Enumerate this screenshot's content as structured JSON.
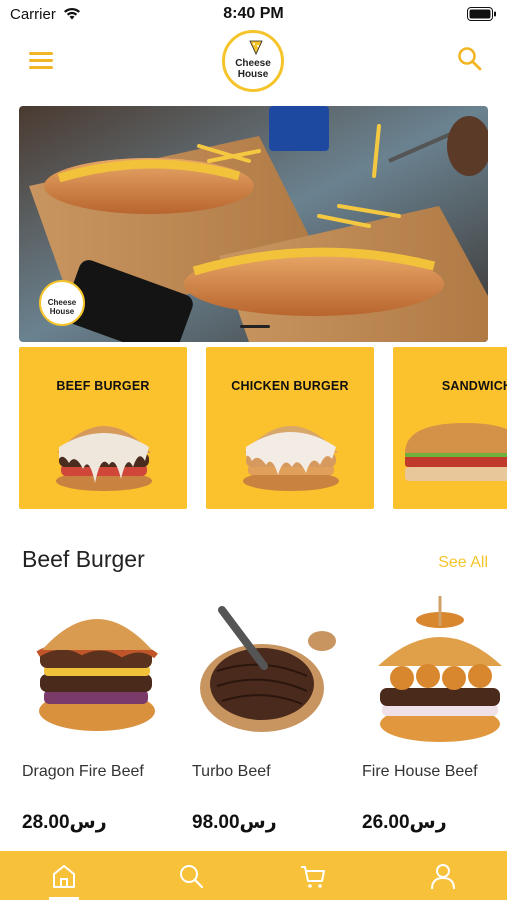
{
  "status_bar": {
    "carrier": "Carrier",
    "time": "8:40 PM"
  },
  "header": {
    "logo_line1": "Cheese",
    "logo_line2": "House",
    "menu_icon": "hamburger-icon",
    "search_icon": "search-icon"
  },
  "banner": {
    "logo_line1": "Cheese",
    "logo_line2": "House",
    "page_indicator": "1 of carousel"
  },
  "categories": [
    {
      "label": "BEEF BURGER"
    },
    {
      "label": "CHICKEN BURGER"
    },
    {
      "label": "SANDWICH"
    }
  ],
  "section": {
    "title": "Beef Burger",
    "see_all": "See All"
  },
  "products": [
    {
      "name": "Dragon Fire Beef",
      "price": "28.00رس"
    },
    {
      "name": "Turbo Beef",
      "price": "98.00رس"
    },
    {
      "name": "Fire House Beef",
      "price": "26.00رس"
    }
  ],
  "tabbar": {
    "tabs": [
      "home-icon",
      "search-icon",
      "cart-icon",
      "user-icon"
    ],
    "active": "home-icon"
  },
  "colors": {
    "accent": "#fcc22d",
    "tabbar": "#f8c13a",
    "see_all": "#f5c42b"
  }
}
